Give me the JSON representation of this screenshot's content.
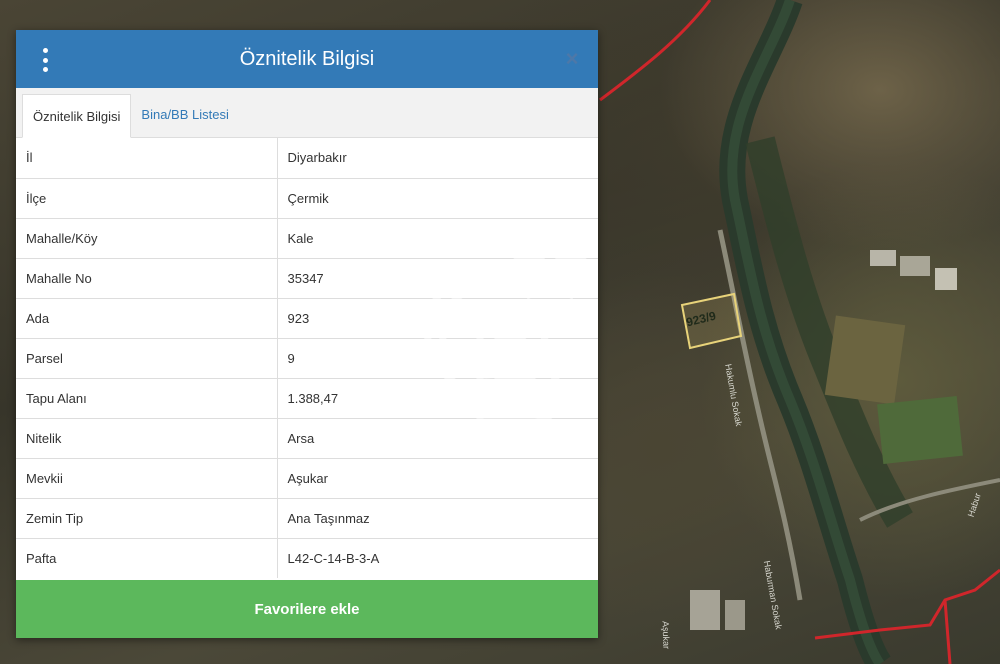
{
  "panel": {
    "title": "Öznitelik Bilgisi",
    "close_glyph": "×",
    "menu_icon": "vertical-dots-icon"
  },
  "tabs": [
    {
      "label": "Öznitelik Bilgisi",
      "active": true
    },
    {
      "label": "Bina/BB Listesi",
      "active": false
    }
  ],
  "attributes": [
    {
      "key": "İl",
      "value": "Diyarbakır"
    },
    {
      "key": "İlçe",
      "value": "Çermik"
    },
    {
      "key": "Mahalle/Köy",
      "value": "Kale"
    },
    {
      "key": "Mahalle No",
      "value": "35347"
    },
    {
      "key": "Ada",
      "value": "923"
    },
    {
      "key": "Parsel",
      "value": "9"
    },
    {
      "key": "Tapu Alanı",
      "value": "1.388,47"
    },
    {
      "key": "Nitelik",
      "value": "Arsa"
    },
    {
      "key": "Mevkii",
      "value": "Aşukar"
    },
    {
      "key": "Zemin Tip",
      "value": "Ana Taşınmaz"
    },
    {
      "key": "Pafta",
      "value": "L42-C-14-B-3-A"
    }
  ],
  "actions": {
    "favorite_label": "Favorilere ekle"
  },
  "map": {
    "parcel_label": "923/9",
    "street_labels": [
      "Hakumlu Sokak",
      "Haburman Sokak",
      "Aşukar",
      "Habur"
    ],
    "watermark_logo": "CB"
  },
  "colors": {
    "header": "#337ab7",
    "button": "#5cb85c",
    "boundary": "#d0262b",
    "parcel_outline": "#e8d37a"
  }
}
